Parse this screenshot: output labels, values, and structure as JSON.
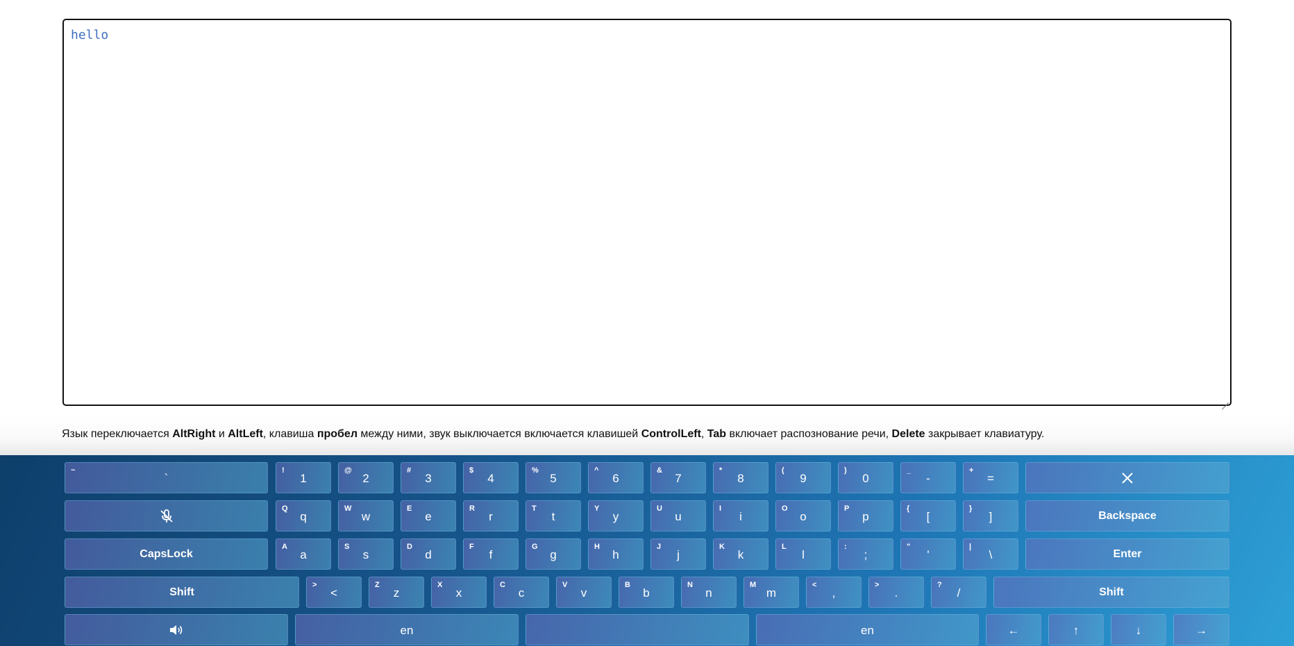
{
  "editor": {
    "text": "hello"
  },
  "hint": {
    "p1": "Язык переключается ",
    "k1": "AltRight",
    "p2": " и ",
    "k2": "AltLeft",
    "p3": ", клавиша ",
    "k3": "пробел",
    "p4": " между ними, звук выключается включается клавишей ",
    "k4": "ControlLeft",
    "p5": ", ",
    "k5": "Tab",
    "p6": " включает распознование речи, ",
    "k6": "Delete",
    "p7": " закрывает клавиатуру."
  },
  "keyboard": {
    "row1": [
      {
        "alt": "~",
        "main": "`"
      },
      {
        "alt": "!",
        "main": "1"
      },
      {
        "alt": "@",
        "main": "2"
      },
      {
        "alt": "#",
        "main": "3"
      },
      {
        "alt": "$",
        "main": "4"
      },
      {
        "alt": "%",
        "main": "5"
      },
      {
        "alt": "^",
        "main": "6"
      },
      {
        "alt": "&",
        "main": "7"
      },
      {
        "alt": "*",
        "main": "8"
      },
      {
        "alt": "(",
        "main": "9"
      },
      {
        "alt": ")",
        "main": "0"
      },
      {
        "alt": "_",
        "main": "-"
      },
      {
        "alt": "+",
        "main": "="
      }
    ],
    "close_icon": "close-icon",
    "mic_icon": "mic-off-icon",
    "row2": [
      {
        "alt": "Q",
        "main": "q"
      },
      {
        "alt": "W",
        "main": "w"
      },
      {
        "alt": "E",
        "main": "e"
      },
      {
        "alt": "R",
        "main": "r"
      },
      {
        "alt": "T",
        "main": "t"
      },
      {
        "alt": "Y",
        "main": "y"
      },
      {
        "alt": "U",
        "main": "u"
      },
      {
        "alt": "I",
        "main": "i"
      },
      {
        "alt": "O",
        "main": "o"
      },
      {
        "alt": "P",
        "main": "p"
      },
      {
        "alt": "{",
        "main": "["
      },
      {
        "alt": "}",
        "main": "]"
      }
    ],
    "backspace": "Backspace",
    "capslock": "CapsLock",
    "row3": [
      {
        "alt": "A",
        "main": "a"
      },
      {
        "alt": "S",
        "main": "s"
      },
      {
        "alt": "D",
        "main": "d"
      },
      {
        "alt": "F",
        "main": "f"
      },
      {
        "alt": "G",
        "main": "g"
      },
      {
        "alt": "H",
        "main": "h"
      },
      {
        "alt": "J",
        "main": "j"
      },
      {
        "alt": "K",
        "main": "k"
      },
      {
        "alt": "L",
        "main": "l"
      },
      {
        "alt": ":",
        "main": ";"
      },
      {
        "alt": "\"",
        "main": "'"
      },
      {
        "alt": "|",
        "main": "\\"
      }
    ],
    "enter": "Enter",
    "shift_left": "Shift",
    "row4": [
      {
        "alt": ">",
        "main": "<"
      },
      {
        "alt": "Z",
        "main": "z"
      },
      {
        "alt": "X",
        "main": "x"
      },
      {
        "alt": "C",
        "main": "c"
      },
      {
        "alt": "V",
        "main": "v"
      },
      {
        "alt": "B",
        "main": "b"
      },
      {
        "alt": "N",
        "main": "n"
      },
      {
        "alt": "M",
        "main": "m"
      },
      {
        "alt": "<",
        "main": ","
      },
      {
        "alt": ">",
        "main": "."
      },
      {
        "alt": "?",
        "main": "/"
      }
    ],
    "shift_right": "Shift",
    "sound_icon": "speaker-icon",
    "lang_left": "en",
    "space": "",
    "lang_right": "en",
    "arrows": [
      "←",
      "↑",
      "↓",
      "→"
    ]
  }
}
